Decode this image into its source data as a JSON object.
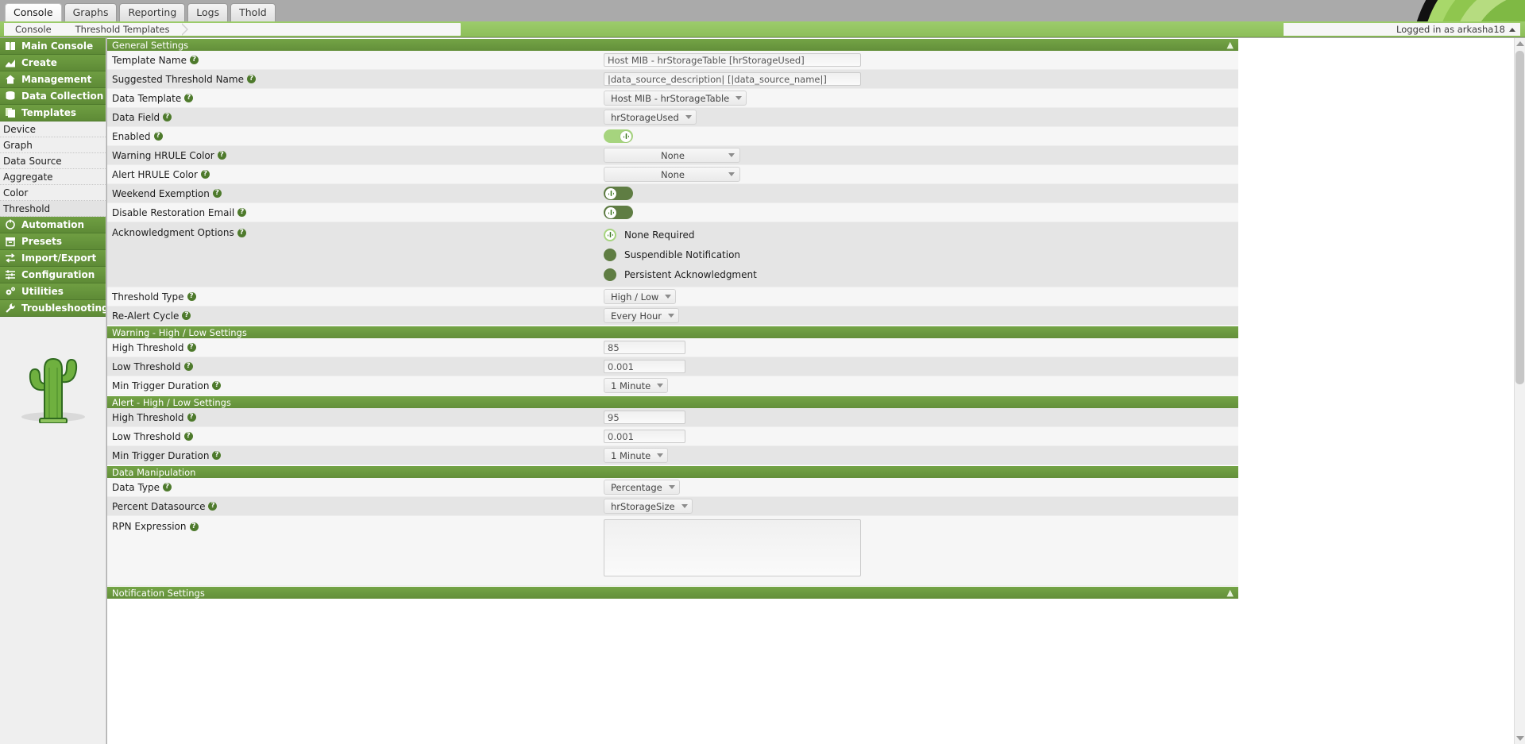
{
  "app": {
    "accent": "#6f9e42",
    "header_green": "#74a446",
    "toggle_on": "#a6d47e",
    "toggle_off": "#5f7d43"
  },
  "topbar": {
    "tabs": [
      {
        "label": "Console",
        "active": true
      },
      {
        "label": "Graphs",
        "active": false
      },
      {
        "label": "Reporting",
        "active": false
      },
      {
        "label": "Logs",
        "active": false
      },
      {
        "label": "Thold",
        "active": false
      }
    ]
  },
  "breadcrumb": {
    "items": [
      "Console",
      "Threshold Templates"
    ],
    "login_text": "Logged in as arkasha18"
  },
  "sidebar": {
    "sections": [
      {
        "label": "Main Console",
        "icon": "book-icon"
      },
      {
        "label": "Create",
        "icon": "chart-icon"
      },
      {
        "label": "Management",
        "icon": "home-icon"
      },
      {
        "label": "Data Collection",
        "icon": "database-icon"
      },
      {
        "label": "Templates",
        "icon": "copy-icon"
      }
    ],
    "template_items": [
      {
        "label": "Device",
        "active": false
      },
      {
        "label": "Graph",
        "active": false
      },
      {
        "label": "Data Source",
        "active": false
      },
      {
        "label": "Aggregate",
        "active": false
      },
      {
        "label": "Color",
        "active": false
      },
      {
        "label": "Threshold",
        "active": true
      }
    ],
    "sections_after": [
      {
        "label": "Automation",
        "icon": "gear-circle-icon"
      },
      {
        "label": "Presets",
        "icon": "archive-icon"
      },
      {
        "label": "Import/Export",
        "icon": "exchange-icon"
      },
      {
        "label": "Configuration",
        "icon": "sliders-icon"
      },
      {
        "label": "Utilities",
        "icon": "cogs-icon"
      },
      {
        "label": "Troubleshooting",
        "icon": "wrench-icon"
      }
    ]
  },
  "form": {
    "general": {
      "header": "General Settings",
      "collapse_icon": "▲",
      "template_name": {
        "label": "Template Name",
        "value": "Host MIB - hrStorageTable [hrStorageUsed]"
      },
      "suggested_name": {
        "label": "Suggested Threshold Name",
        "value": "|data_source_description| [|data_source_name|]"
      },
      "data_template": {
        "label": "Data Template",
        "value": "Host MIB - hrStorageTable"
      },
      "data_field": {
        "label": "Data Field",
        "value": "hrStorageUsed"
      },
      "enabled": {
        "label": "Enabled",
        "state": "on"
      },
      "warning_hrule_color": {
        "label": "Warning HRULE Color",
        "value": "None"
      },
      "alert_hrule_color": {
        "label": "Alert HRULE Color",
        "value": "None"
      },
      "weekend_exemption": {
        "label": "Weekend Exemption",
        "state": "off"
      },
      "disable_restoration_email": {
        "label": "Disable Restoration Email",
        "state": "off"
      },
      "acknowledgment": {
        "label": "Acknowledgment Options",
        "options": [
          {
            "label": "None Required",
            "selected": true
          },
          {
            "label": "Suspendible Notification",
            "selected": false
          },
          {
            "label": "Persistent Acknowledgment",
            "selected": false
          }
        ]
      },
      "threshold_type": {
        "label": "Threshold Type",
        "value": "High / Low"
      },
      "realert_cycle": {
        "label": "Re-Alert Cycle",
        "value": "Every Hour"
      }
    },
    "warning": {
      "header": "Warning - High / Low Settings",
      "high_threshold": {
        "label": "High Threshold",
        "value": "85"
      },
      "low_threshold": {
        "label": "Low Threshold",
        "value": "0.001"
      },
      "min_trigger_duration": {
        "label": "Min Trigger Duration",
        "value": "1 Minute"
      }
    },
    "alert": {
      "header": "Alert - High / Low Settings",
      "high_threshold": {
        "label": "High Threshold",
        "value": "95"
      },
      "low_threshold": {
        "label": "Low Threshold",
        "value": "0.001"
      },
      "min_trigger_duration": {
        "label": "Min Trigger Duration",
        "value": "1 Minute"
      }
    },
    "data_manipulation": {
      "header": "Data Manipulation",
      "data_type": {
        "label": "Data Type",
        "value": "Percentage"
      },
      "percent_datasource": {
        "label": "Percent Datasource",
        "value": "hrStorageSize"
      },
      "rpn_expression": {
        "label": "RPN Expression",
        "value": ""
      }
    },
    "notification": {
      "header": "Notification Settings",
      "collapse_icon": "▲"
    }
  }
}
